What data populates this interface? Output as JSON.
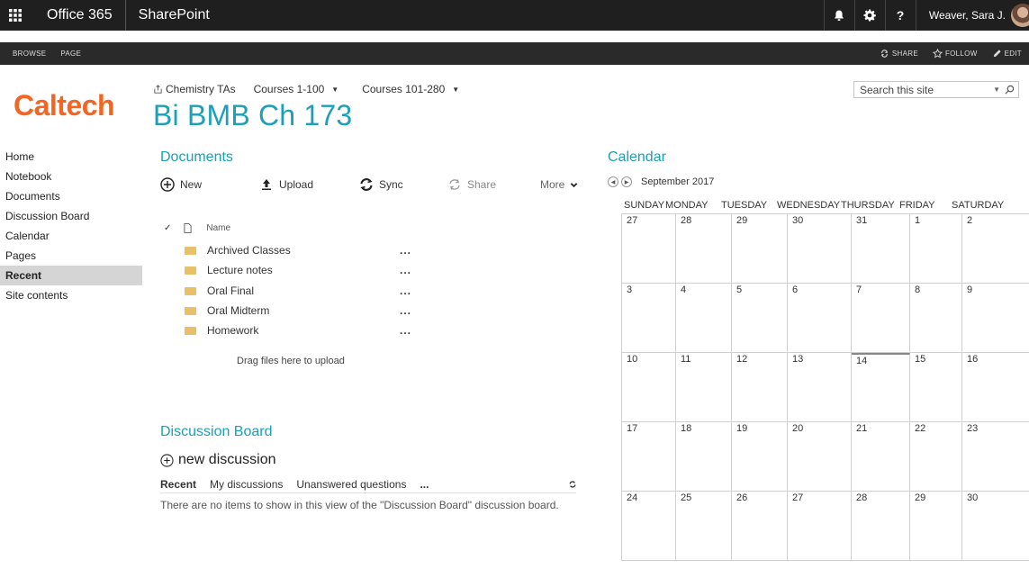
{
  "suitebar": {
    "app": "Office 365",
    "product": "SharePoint",
    "user": "Weaver, Sara J.",
    "icons": [
      "app-launcher-icon",
      "bell-icon",
      "gear-icon",
      "help-icon"
    ]
  },
  "ribbon": {
    "tabs": [
      "BROWSE",
      "PAGE"
    ],
    "actions": [
      "SHARE",
      "FOLLOW",
      "EDIT"
    ]
  },
  "header": {
    "logo": "Caltech",
    "site_title": "Bi BMB Ch 173",
    "topnav": [
      "Chemistry TAs",
      "Courses 1-100",
      "Courses 101-280"
    ],
    "search_placeholder": "Search this site"
  },
  "leftnav": {
    "items": [
      "Home",
      "Notebook",
      "Documents",
      "Discussion Board",
      "Calendar",
      "Pages",
      "Recent",
      "Site contents"
    ],
    "selected": "Recent"
  },
  "documents": {
    "title": "Documents",
    "toolbar": {
      "new": "New",
      "upload": "Upload",
      "sync": "Sync",
      "share": "Share",
      "more": "More"
    },
    "column_name": "Name",
    "folders": [
      "Archived Classes",
      "Lecture notes",
      "Oral Final",
      "Oral Midterm",
      "Homework"
    ],
    "row_menu": "...",
    "drag_hint": "Drag files here to upload"
  },
  "discussion": {
    "title": "Discussion Board",
    "new_label": "new discussion",
    "tabs": [
      "Recent",
      "My discussions",
      "Unanswered questions",
      "..."
    ],
    "empty": "There are no items to show in this view of the \"Discussion Board\" discussion board."
  },
  "calendar": {
    "title": "Calendar",
    "month": "September 2017",
    "days": [
      "SUNDAY",
      "MONDAY",
      "TUESDAY",
      "WEDNESDAY",
      "THURSDAY",
      "FRIDAY",
      "SATURDAY"
    ],
    "weeks": [
      [
        "27",
        "28",
        "29",
        "30",
        "31",
        "1",
        "2"
      ],
      [
        "3",
        "4",
        "5",
        "6",
        "7",
        "8",
        "9"
      ],
      [
        "10",
        "11",
        "12",
        "13",
        "14",
        "15",
        "16"
      ],
      [
        "17",
        "18",
        "19",
        "20",
        "21",
        "22",
        "23"
      ],
      [
        "24",
        "25",
        "26",
        "27",
        "28",
        "29",
        "30"
      ]
    ],
    "today": "14",
    "colors": {
      "accent": "#1ca0b7",
      "brand": "#f26522"
    }
  }
}
